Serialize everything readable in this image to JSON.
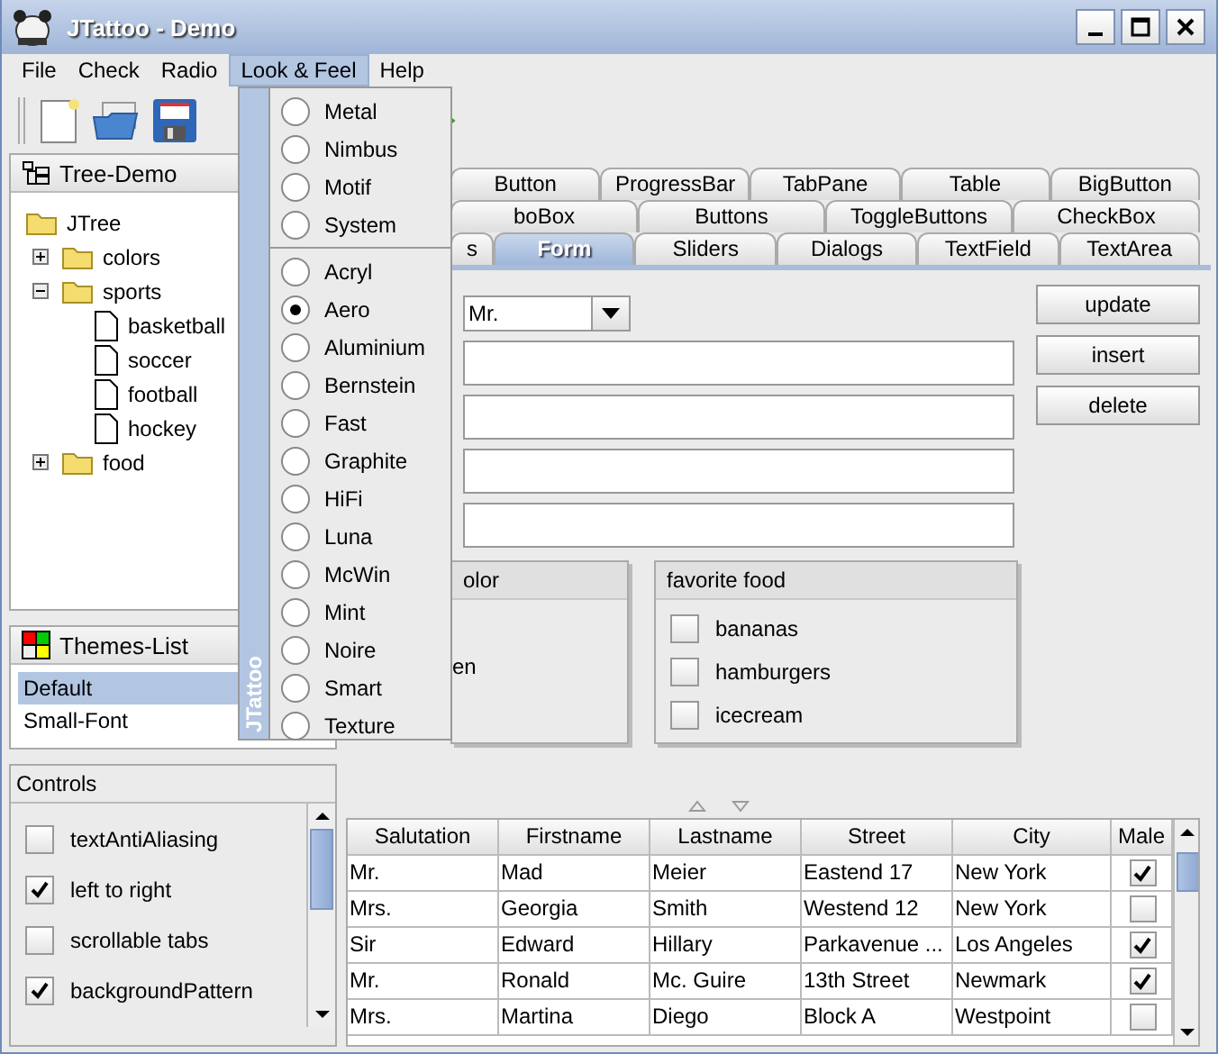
{
  "window": {
    "title": "JTattoo - Demo"
  },
  "menu_bar": [
    {
      "label": "File",
      "selected": false
    },
    {
      "label": "Check",
      "selected": false
    },
    {
      "label": "Radio",
      "selected": false
    },
    {
      "label": "Look & Feel",
      "selected": true
    },
    {
      "label": "Help",
      "selected": false
    }
  ],
  "look_and_feel_menu": {
    "side_label": "JTattoo",
    "groups": [
      [
        {
          "label": "Metal",
          "selected": false
        },
        {
          "label": "Nimbus",
          "selected": false
        },
        {
          "label": "Motif",
          "selected": false
        },
        {
          "label": "System",
          "selected": false
        }
      ],
      [
        {
          "label": "Acryl",
          "selected": false
        },
        {
          "label": "Aero",
          "selected": true
        },
        {
          "label": "Aluminium",
          "selected": false
        },
        {
          "label": "Bernstein",
          "selected": false
        },
        {
          "label": "Fast",
          "selected": false
        },
        {
          "label": "Graphite",
          "selected": false
        },
        {
          "label": "HiFi",
          "selected": false
        },
        {
          "label": "Luna",
          "selected": false
        },
        {
          "label": "McWin",
          "selected": false
        },
        {
          "label": "Mint",
          "selected": false
        },
        {
          "label": "Noire",
          "selected": false
        },
        {
          "label": "Smart",
          "selected": false
        },
        {
          "label": "Texture",
          "selected": false
        }
      ]
    ]
  },
  "tree_panel": {
    "title": "Tree-Demo",
    "root": {
      "label": "JTree",
      "children": [
        {
          "label": "colors",
          "kind": "folder",
          "expanded": false
        },
        {
          "label": "sports",
          "kind": "folder",
          "expanded": true,
          "children": [
            {
              "label": "basketball"
            },
            {
              "label": "soccer"
            },
            {
              "label": "football"
            },
            {
              "label": "hockey"
            }
          ]
        },
        {
          "label": "food",
          "kind": "folder",
          "expanded": false
        }
      ]
    }
  },
  "themes_panel": {
    "title": "Themes-List",
    "items": [
      {
        "label": "Default",
        "selected": true
      },
      {
        "label": "Small-Font",
        "selected": false
      }
    ]
  },
  "controls_panel": {
    "title": "Controls",
    "items": [
      {
        "label": "textAntiAliasing",
        "checked": false
      },
      {
        "label": "left to right",
        "checked": true
      },
      {
        "label": "scrollable tabs",
        "checked": false
      },
      {
        "label": "backgroundPattern",
        "checked": true
      }
    ]
  },
  "tab_rows": [
    {
      "tabs": [
        {
          "label": "Button",
          "selected": false
        },
        {
          "label": "ProgressBar",
          "selected": false
        },
        {
          "label": "TabPane",
          "selected": false
        },
        {
          "label": "Table",
          "selected": false
        },
        {
          "label": "BigButton",
          "selected": false
        }
      ]
    },
    {
      "tabs": [
        {
          "label": "boBox",
          "selected": false
        },
        {
          "label": "Buttons",
          "selected": false
        },
        {
          "label": "ToggleButtons",
          "selected": false
        },
        {
          "label": "CheckBox",
          "selected": false
        }
      ]
    },
    {
      "tabs": [
        {
          "label": "s",
          "selected": false
        },
        {
          "label": "Form",
          "selected": true
        },
        {
          "label": "Sliders",
          "selected": false
        },
        {
          "label": "Dialogs",
          "selected": false
        },
        {
          "label": "TextField",
          "selected": false
        },
        {
          "label": "TextArea",
          "selected": false
        }
      ]
    }
  ],
  "form": {
    "salutation": "Mr.",
    "buttons": [
      "update",
      "insert",
      "delete"
    ],
    "color_group": {
      "title": "olor",
      "items": [
        "en"
      ]
    },
    "food_group": {
      "title": "favorite food",
      "items": [
        {
          "label": "bananas",
          "checked": false
        },
        {
          "label": "hamburgers",
          "checked": false
        },
        {
          "label": "icecream",
          "checked": false
        }
      ]
    }
  },
  "table": {
    "columns": [
      "Salutation",
      "Firstname",
      "Lastname",
      "Street",
      "City",
      "Male"
    ],
    "rows": [
      {
        "cells": [
          "Mr.",
          "Mad",
          "Meier",
          "Eastend 17",
          "New York"
        ],
        "male": true
      },
      {
        "cells": [
          "Mrs.",
          "Georgia",
          "Smith",
          "Westend 12",
          "New York"
        ],
        "male": false
      },
      {
        "cells": [
          "Sir",
          "Edward",
          "Hillary",
          "Parkavenue ...",
          "Los Angeles"
        ],
        "male": true
      },
      {
        "cells": [
          "Mr.",
          "Ronald",
          "Mc. Guire",
          "13th Street",
          "Newmark"
        ],
        "male": true
      },
      {
        "cells": [
          "Mrs.",
          "Martina",
          "Diego",
          "Block A",
          "Westpoint"
        ],
        "male": false
      }
    ]
  }
}
